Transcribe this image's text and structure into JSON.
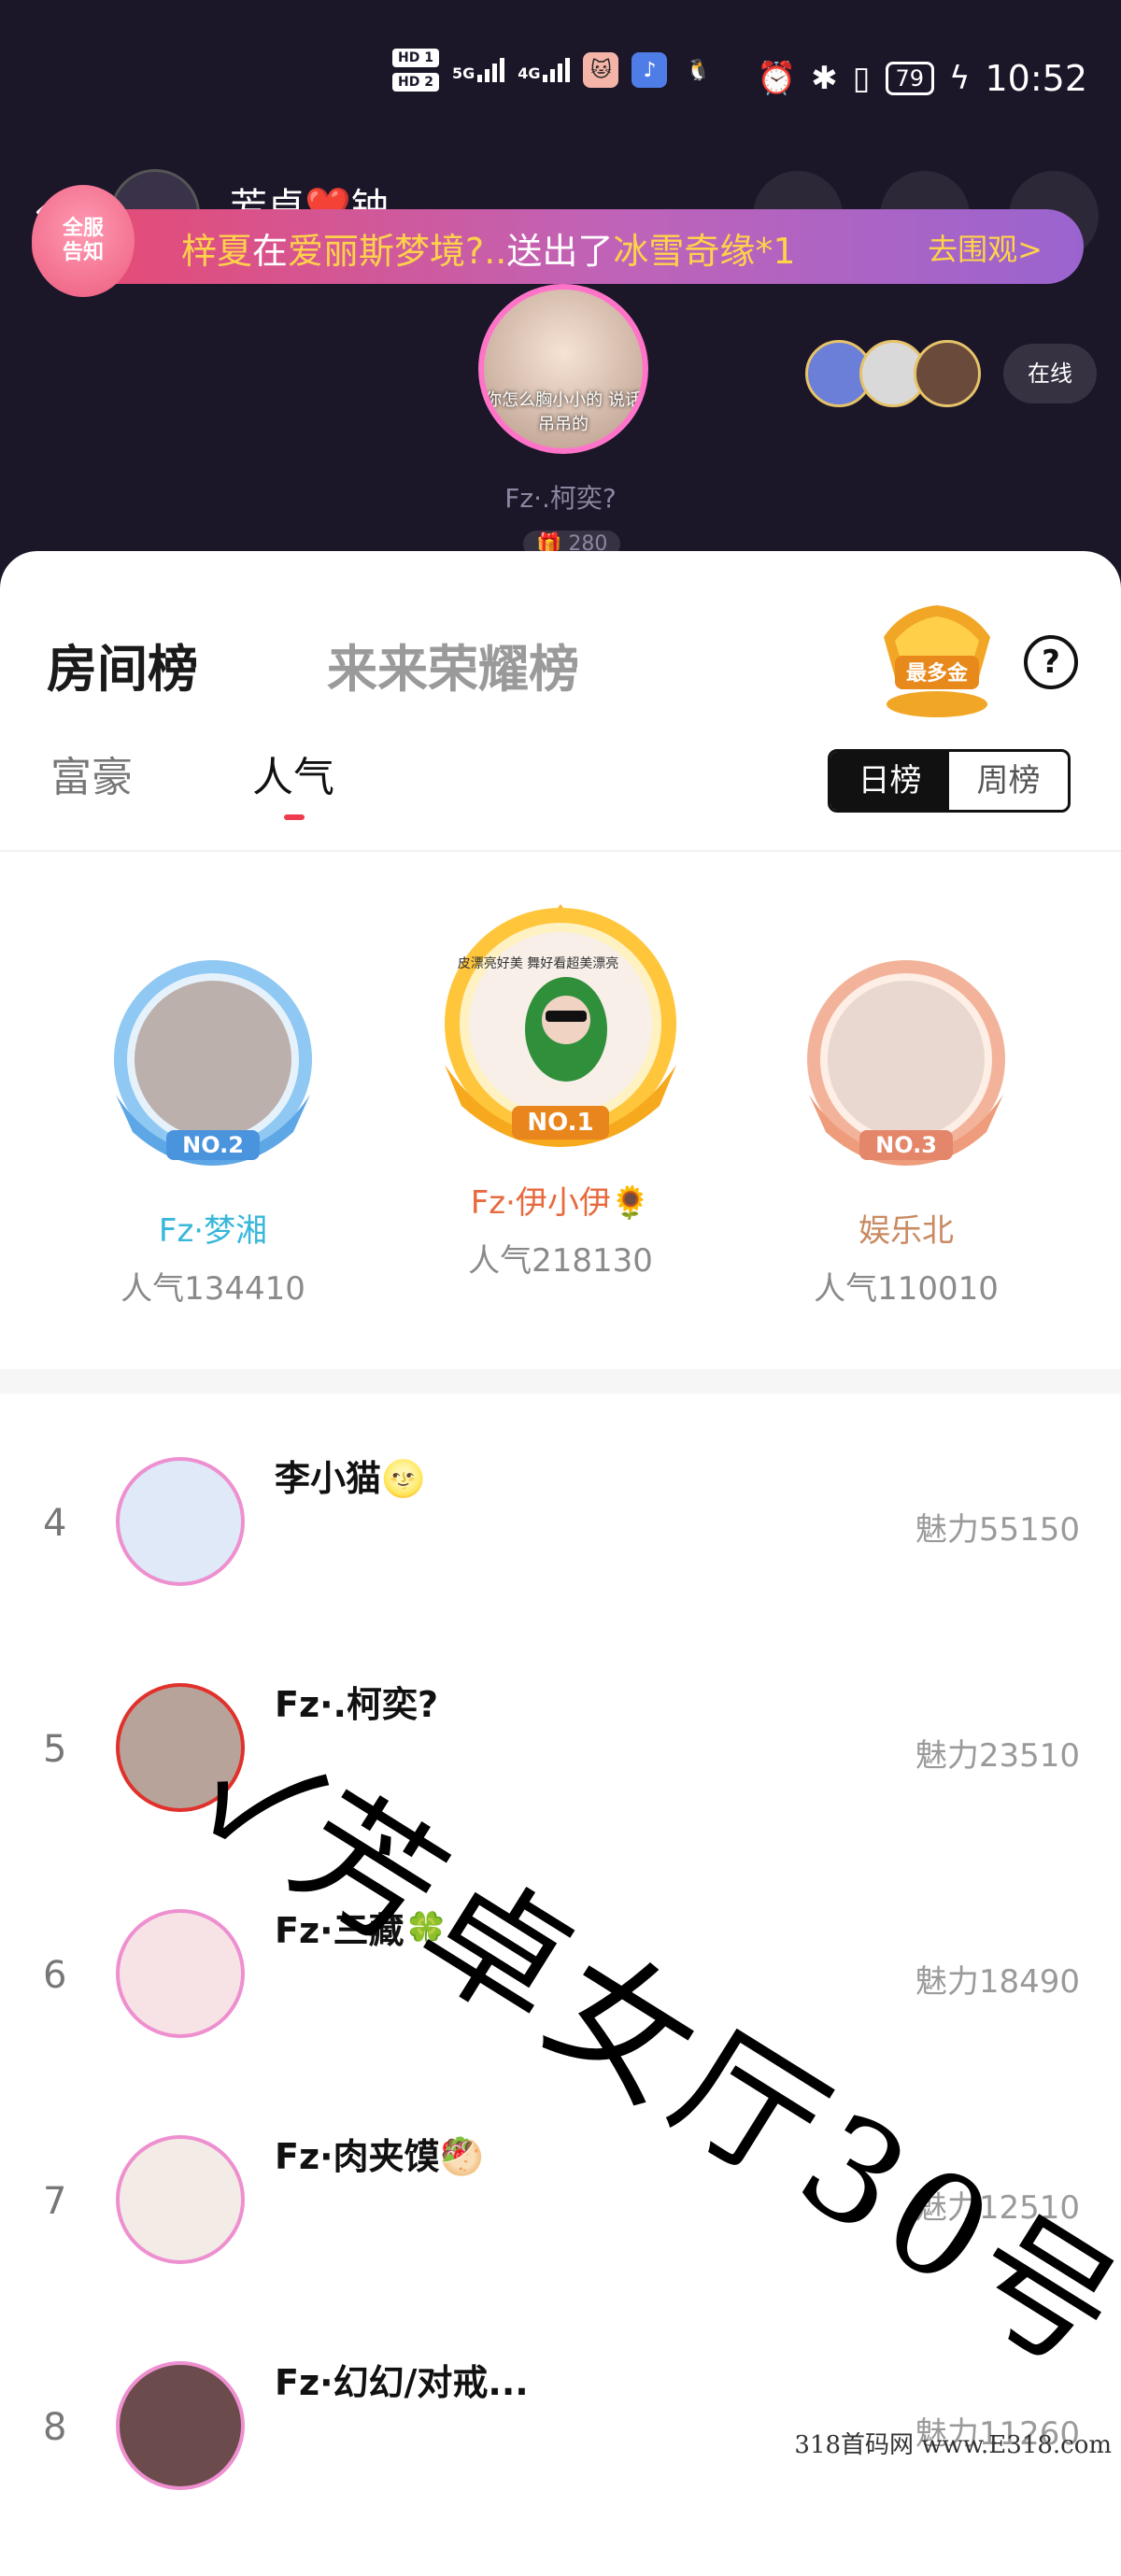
{
  "status_bar": {
    "hd1": "HD 1",
    "hd2": "HD 2",
    "net1": "5G",
    "net2": "4G",
    "battery": "79",
    "time": "10:52"
  },
  "room": {
    "host_name": "芳卓❤️钟..",
    "notice_badge": "全服\n告知",
    "notice_user": "梓夏",
    "notice_in": "在",
    "notice_room": "爱丽斯梦境?..",
    "notice_sent": "送出了",
    "notice_gift": "冰雪奇缘*1",
    "notice_link": "去围观>",
    "singer_caption": "你怎么胸小小的 说话吊吊的",
    "singer_name": "Fz·.柯奕?",
    "gift_count": "280",
    "online_label": "在线"
  },
  "tabs": {
    "main": [
      "房间榜",
      "来来荣耀榜"
    ],
    "award_label": "最多金",
    "sub": [
      "富豪",
      "人气"
    ],
    "period": [
      "日榜",
      "周榜"
    ]
  },
  "podium": [
    {
      "rank_label": "NO.2",
      "name": "Fz·梦湘",
      "score": "人气134410",
      "name_color": "#38b7da"
    },
    {
      "rank_label": "NO.1",
      "name": "Fz·伊小伊🌻",
      "score": "人气218130",
      "name_color": "#e76a3f",
      "frame_text": "皮漂亮好美 舞好看超美漂亮"
    },
    {
      "rank_label": "NO.3",
      "name": "娱乐北",
      "score": "人气110010",
      "name_color": "#c98a62"
    }
  ],
  "list": [
    {
      "rank": "4",
      "name": "李小猫🌝",
      "score": "魅力55150"
    },
    {
      "rank": "5",
      "name": "Fz·.柯奕?",
      "score": "魅力23510"
    },
    {
      "rank": "6",
      "name": "Fz·三藏🍀",
      "score": "魅力18490"
    },
    {
      "rank": "7",
      "name": "Fz·肉夹馍🥙",
      "score": "魅力12510"
    },
    {
      "rank": "8",
      "name": "Fz·幻幻/对戒...",
      "score": "魅力11260"
    }
  ],
  "watermark": "✓芳卓女厅30号",
  "site_mark": "318首码网 www.E318.com"
}
